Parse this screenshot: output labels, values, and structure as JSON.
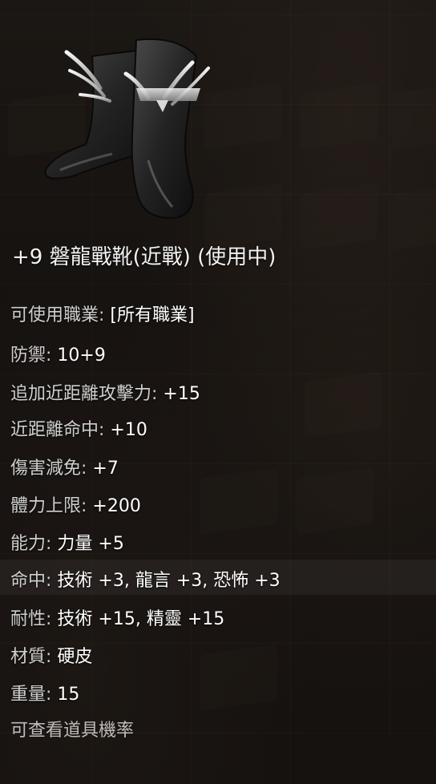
{
  "item": {
    "name": "+9 磐龍戰靴(近戰) (使用中)",
    "icon": "boots-icon"
  },
  "stats": [
    {
      "label": "可使用職業:",
      "value": "[所有職業]"
    },
    {
      "label": "防禦:",
      "value": "10+9"
    },
    {
      "label": "追加近距離攻擊力:",
      "value": "+15"
    },
    {
      "label": "近距離命中:",
      "value": "+10"
    },
    {
      "label": "傷害減免:",
      "value": "+7"
    },
    {
      "label": "體力上限:",
      "value": "+200"
    },
    {
      "label": "能力:",
      "value": "力量 +5"
    },
    {
      "label": "命中:",
      "value": "技術 +3, 龍言 +3, 恐怖 +3"
    },
    {
      "label": "耐性:",
      "value": "技術 +15, 精靈 +15"
    },
    {
      "label": "材質:",
      "value": "硬皮"
    },
    {
      "label": "重量:",
      "value": "15"
    }
  ],
  "footer": {
    "link": "可查看道具機率"
  },
  "colors": {
    "text": "#e8e8e8",
    "label": "#cfcfcf",
    "footer": "#bdbdbd",
    "background": "#1f1a17"
  }
}
